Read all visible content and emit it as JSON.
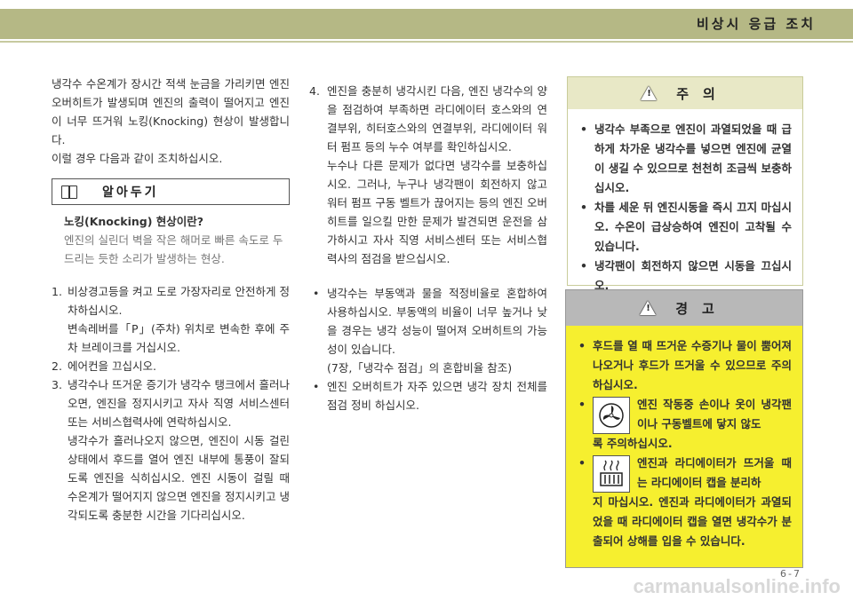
{
  "header": {
    "title": "비상시 응급 조치"
  },
  "col1": {
    "intro": [
      "냉각수 수온계가 장시간 적색 눈금을 가리키면 엔진 오버히트가 발생되며 엔진의 출력이 떨어지고 엔진이 너무 뜨거워 노킹(Knocking) 현상이 발생합니다.",
      "이럴 경우 다음과 같이 조치하십시오."
    ],
    "memo": {
      "title": "알아두기",
      "heading": "노킹(Knocking) 현상이란?",
      "text": "엔진의 실린더 벽을 작은 해머로 빠른 속도로 두드리는 듯한 소리가 발생하는 현상."
    },
    "steps": [
      {
        "num": "1.",
        "lines": [
          "비상경고등을 켜고 도로 가장자리로 안전하게 정차하십시오.",
          "변속레버를「P」(주차) 위치로 변속한 후에 주차 브레이크를 거십시오."
        ]
      },
      {
        "num": "2.",
        "lines": [
          "에어컨을 끄십시오."
        ]
      },
      {
        "num": "3.",
        "lines": [
          "냉각수나 뜨거운 증기가 냉각수 탱크에서 흘러나오면, 엔진을 정지시키고 자사 직영 서비스센터 또는 서비스협력사에 연락하십시오.",
          "냉각수가 흘러나오지 않으면, 엔진이 시동 걸린 상태에서 후드를 열어 엔진 내부에 통풍이 잘되도록 엔진을 식히십시오. 엔진 시동이 걸릴 때 수온계가 떨어지지 않으면 엔진을 정지시키고 냉각되도록 충분한 시간을 기다리십시오."
        ]
      }
    ]
  },
  "col2": {
    "steps": [
      {
        "num": "4.",
        "lines": [
          "엔진을 충분히 냉각시킨 다음, 엔진 냉각수의 양을 점검하여 부족하면 라디에이터 호스와의 연결부위, 히터호스와의 연결부위, 라디에이터 워터 펌프 등의 누수 여부를 확인하십시오.",
          "누수나 다른 문제가 없다면 냉각수를 보충하십시오. 그러나, 누구나 냉각팬이 회전하지 않고 워터 펌프 구동 벨트가 끊어지는 등의 엔진 오버히트를 일으킬 만한 문제가 발견되면 운전을 삼가하시고 자사 직영 서비스센터 또는 서비스협력사의 점검을 받으십시오."
        ]
      }
    ],
    "bullets": [
      {
        "dot": "•",
        "lines": [
          "냉각수는 부동액과 물을 적정비율로 혼합하여 사용하십시오. 부동액의 비율이 너무 높거나 낮을 경우는 냉각 성능이 떨어져 오버히트의 가능성이 있습니다.",
          "(7장,「냉각수 점검」의 혼합비율 참조)"
        ]
      },
      {
        "dot": "•",
        "lines": [
          "엔진 오버히트가 자주 있으면 냉각 장치 전체를 점검 정비 하십시오."
        ]
      }
    ]
  },
  "caution": {
    "title": "주의",
    "icon_symbol": "!",
    "items": [
      "냉각수 부족으로 엔진이 과열되었을 때 급하게 차가운 냉각수를 넣으면 엔진에 균열이 생길 수 있으므로 천천히 조금씩 보충하십시오.",
      "차를 세운 뒤 엔진시동을 즉시 끄지 마십시오. 수온이 급상승하여 엔진이 고착될 수 있습니다.",
      "냉각팬이 회전하지 않으면 시동을 끄십시오."
    ]
  },
  "warning": {
    "title": "경고",
    "icon_symbol": "!",
    "item1": "후드를 열 때 뜨거운 수증기나 물이 뿜어져 나오거나 후드가 뜨거울 수 있으므로 주의하십시오.",
    "item2_side": "엔진 작동중 손이나 옷이 냉각팬이나 구동벨트에 닿지 않도",
    "item2_rest": "록 주의하십시오.",
    "item3_side": "엔진과 라디에이터가 뜨거울 때는 라디에이터 캡을 분리하",
    "item3_rest": "지 마십시오. 엔진과 라디에이터가 과열되었을 때 라디에이터 캡을 열면 냉각수가 분출되어 상해를 입을 수 있습니다.",
    "bullet": "•"
  },
  "footer": {
    "page": "6-7",
    "watermark": "carmanualsonline.info"
  }
}
